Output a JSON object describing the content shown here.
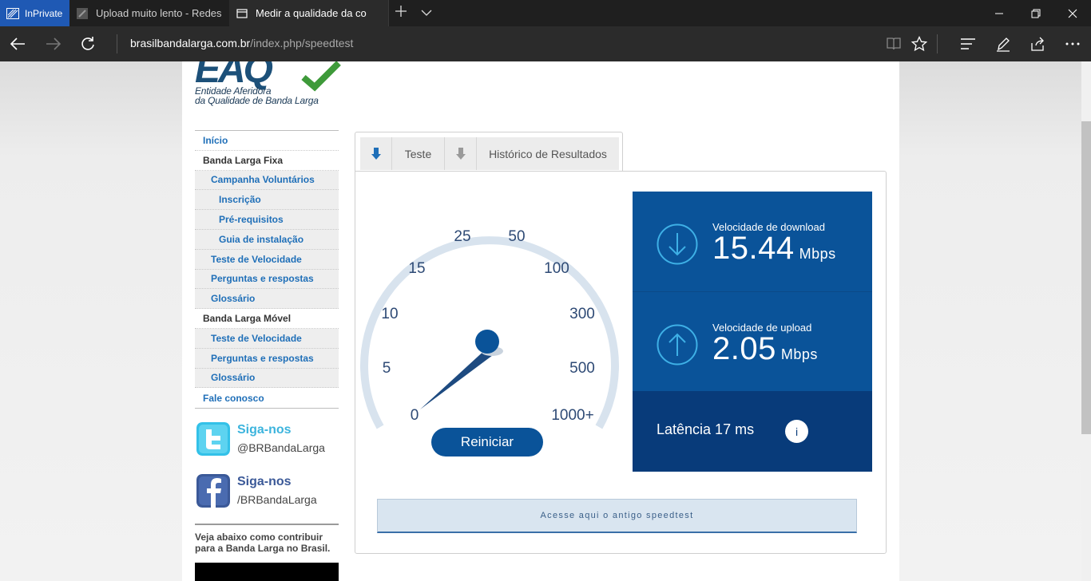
{
  "browser": {
    "inprivate_label": "InPrivate",
    "tabs": [
      {
        "title": "Upload muito lento - Redes"
      },
      {
        "title": "Medir a qualidade da co"
      }
    ],
    "url_domain": "brasilbandalarga.com.br",
    "url_path": "/index.php/speedtest"
  },
  "logo": {
    "lines": [
      "Entidade Aferidora",
      "da Qualidade de Banda Larga"
    ]
  },
  "sidebar": {
    "items": [
      {
        "label": "Início"
      },
      {
        "label": "Banda Larga Fixa"
      },
      {
        "label": "Campanha Voluntários"
      },
      {
        "label": "Inscrição"
      },
      {
        "label": "Pré-requisitos"
      },
      {
        "label": "Guia de instalação"
      },
      {
        "label": "Teste de Velocidade"
      },
      {
        "label": "Perguntas e respostas"
      },
      {
        "label": "Glossário"
      },
      {
        "label": "Banda Larga Móvel"
      },
      {
        "label": "Teste de Velocidade"
      },
      {
        "label": "Perguntas e respostas"
      },
      {
        "label": "Glossário"
      },
      {
        "label": "Fale conosco"
      }
    ]
  },
  "social": {
    "twitter": {
      "title": "Siga-nos",
      "handle": "@BRBandaLarga"
    },
    "facebook": {
      "title": "Siga-nos",
      "handle": "/BRBandaLarga"
    }
  },
  "contribute_text": "Veja abaixo como contribuir para a Banda Larga no Brasil.",
  "speedtest": {
    "tabs": [
      {
        "label": "Teste"
      },
      {
        "label": "Histórico de Resultados"
      }
    ],
    "gauge": {
      "labels": [
        "0",
        "5",
        "10",
        "15",
        "25",
        "50",
        "100",
        "300",
        "500",
        "1000+"
      ],
      "needle_value": 15.44
    },
    "restart_label": "Reiniciar",
    "download": {
      "label": "Velocidade de download",
      "value": "15.44",
      "unit": "Mbps"
    },
    "upload": {
      "label": "Velocidade de upload",
      "value": "2.05",
      "unit": "Mbps"
    },
    "latency": {
      "text": "Latência 17 ms",
      "info": "i"
    },
    "old_link": "Acesse aqui o antigo speedtest"
  },
  "colors": {
    "accent_blue": "#0a5399",
    "dark_blue": "#083b7a",
    "link_blue": "#1f6fb8"
  }
}
